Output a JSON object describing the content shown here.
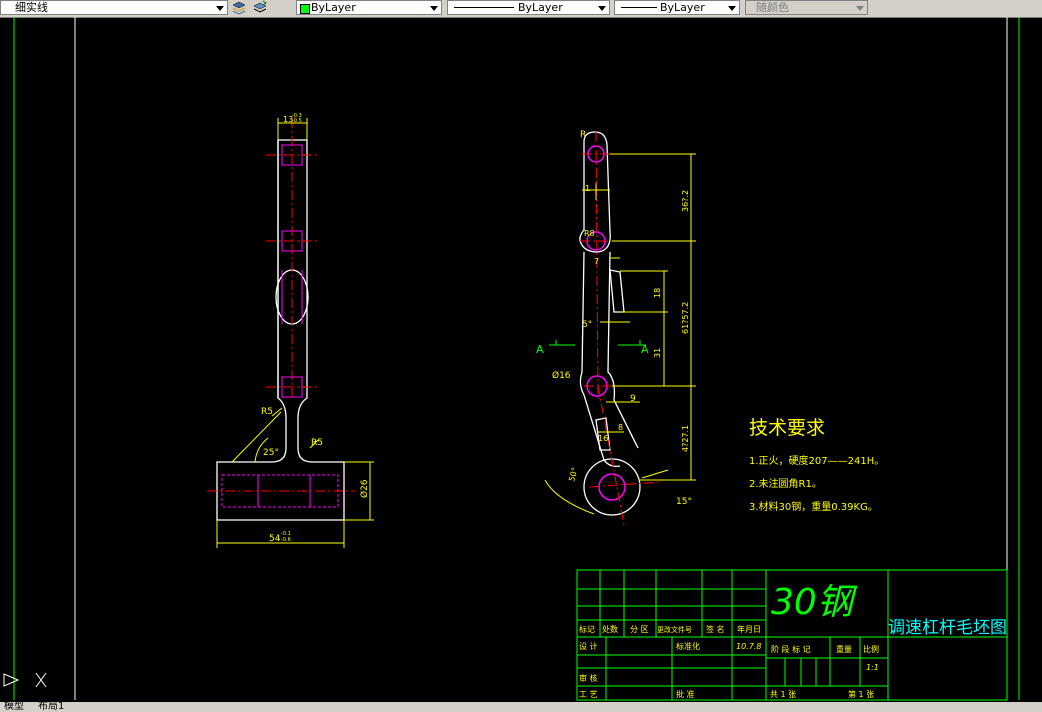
{
  "toolbar": {
    "linetype_combo": "细实线",
    "color_combo": "ByLayer",
    "linetype2_combo": "ByLayer",
    "lineweight_combo": "ByLayer",
    "plotstyle_combo": "随颜色"
  },
  "drawing": {
    "dims_left": {
      "top_width": "13",
      "top_width_tol_upper": "-0.3",
      "top_width_tol_lower": "-0.5",
      "r5_a": "R5",
      "r5_b": "R5",
      "angle": "25°",
      "base_width": "54",
      "base_width_tol_upper": "-0.1",
      "base_width_tol_lower": "-0.6",
      "base_dia": "Ø26"
    },
    "dims_right": {
      "r_top": "R",
      "small_a": "1",
      "r_mid": "R8",
      "seven": "7",
      "dim_367": "36?.2",
      "dim_18": "18",
      "dim_6157": "61?57.2",
      "five_deg": "5°",
      "a_left": "A",
      "a_right": "A",
      "dim_31": "31",
      "dia_16": "Ø16",
      "dim_9": "9",
      "dim_16b": "16",
      "dim_8": "8",
      "dim_4271": "4?27.1",
      "dim_50": "50°",
      "dim_15": "15°"
    },
    "notes": {
      "title": "技术要求",
      "line1": "1.正火，硬度207——241H。",
      "line2": "2.未注圆角R1。",
      "line3": "3.材料30钢，重量0.39KG。"
    },
    "title_block": {
      "material": "30钢",
      "title": "调速杠杆毛坯图",
      "h_mark": "标记",
      "h_count": "处数",
      "h_zone": "分 区",
      "h_docno": "更改文件号",
      "h_sign": "签 名",
      "h_date": "年月日",
      "design": "设 计",
      "standardize": "标准化",
      "date_value": "10.7.8",
      "stage_mark": "阶 段 标 记",
      "weight": "重量",
      "scale": "比例",
      "scale_value": "1:1",
      "review": "审 核",
      "process": "工 艺",
      "approve": "批 准",
      "sheets_total": "共  1  张",
      "sheet_no": "第  1  张"
    }
  },
  "tabs": {
    "model": "模型",
    "layout1": "布局1"
  },
  "colors": {
    "background": "#000000",
    "outline": "#ffffff",
    "dimension": "#ffff00",
    "hidden": "#ff00ff",
    "center": "#ff0000",
    "frame": "#00ff00",
    "annotation": "#00ffff"
  }
}
